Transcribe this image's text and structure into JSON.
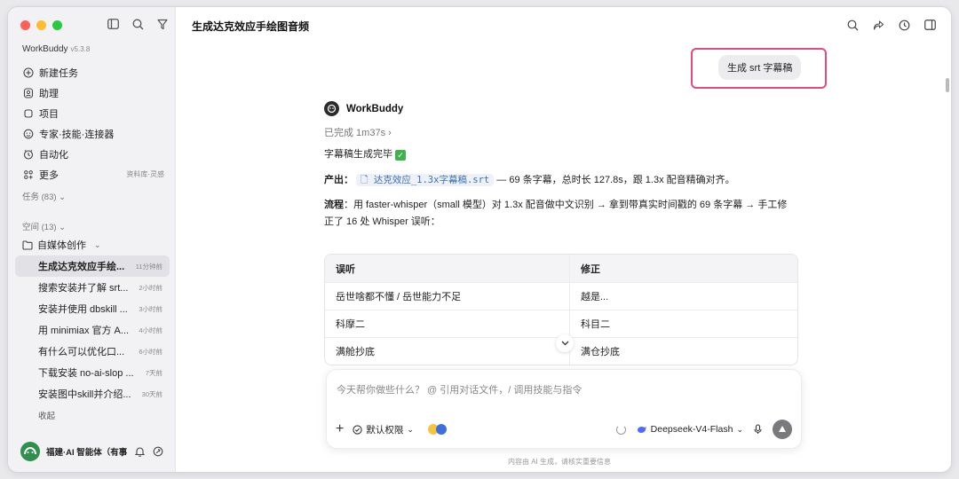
{
  "sidebar": {
    "app_name": "WorkBuddy",
    "version": "v5.3.8",
    "nav": [
      {
        "label": "新建任务",
        "icon": "plus-circle-icon"
      },
      {
        "label": "助理",
        "icon": "assistant-icon"
      },
      {
        "label": "项目",
        "icon": "project-icon"
      },
      {
        "label": "专家·技能·连接器",
        "icon": "expert-icon"
      },
      {
        "label": "自动化",
        "icon": "clock-icon"
      },
      {
        "label": "更多",
        "icon": "grid-icon",
        "extra": "资料库·灵感"
      }
    ],
    "tasks_label": "任务 (83) ⌄",
    "space_label": "空间 (13) ⌄",
    "folder_label": "自媒体创作",
    "tasks": [
      {
        "label": "生成达克效应手绘...",
        "time": "11分钟前"
      },
      {
        "label": "搜索安装并了解 srt...",
        "time": "2小时前"
      },
      {
        "label": "安装并使用 dbskill ...",
        "time": "3小时前"
      },
      {
        "label": "用 minimiax 官方 A...",
        "time": "4小时前"
      },
      {
        "label": "有什么可以优化口...",
        "time": "6小时前"
      },
      {
        "label": "下载安装 no-ai-slop ...",
        "time": "7天前"
      },
      {
        "label": "安装图中skill并介绍...",
        "time": "30天前"
      }
    ],
    "collapse_label": "收起",
    "user_name": "福建·AI 智能体（有事"
  },
  "main": {
    "title": "生成达克效应手绘图音频",
    "user_message": "生成 srt 字幕稿",
    "bot_name": "WorkBuddy",
    "done_text": "已完成 1m37s  ›",
    "line1_text": "字幕稿生成完毕",
    "output_label": "产出",
    "output_file": "达克效应_1.3x字幕稿.srt",
    "output_rest": " — 69 条字幕，总时长 127.8s，跟 1.3x 配音精确对齐。",
    "process_label": "流程",
    "process_text": "：用 faster-whisper（small 模型）对 1.3x 配音做中文识别 → 拿到带真实时间戳的 69 条字幕 → 手工修正了 16 处 Whisper 误听：",
    "table": {
      "headers": [
        "误听",
        "修正"
      ],
      "rows": [
        [
          "岳世啥都不懂 / 岳世能力不足",
          "越是..."
        ],
        [
          "科摩二",
          "科目二"
        ],
        [
          "满舱抄底",
          "满仓抄底"
        ]
      ]
    },
    "composer": {
      "placeholder": "今天帮你做些什么？ @ 引用对话文件，/ 调用技能与指令",
      "permission_label": "默认权限",
      "model_label": "Deepseek-V4-Flash"
    },
    "disclaimer": "内容由 AI 生成，请核实重要信息"
  }
}
